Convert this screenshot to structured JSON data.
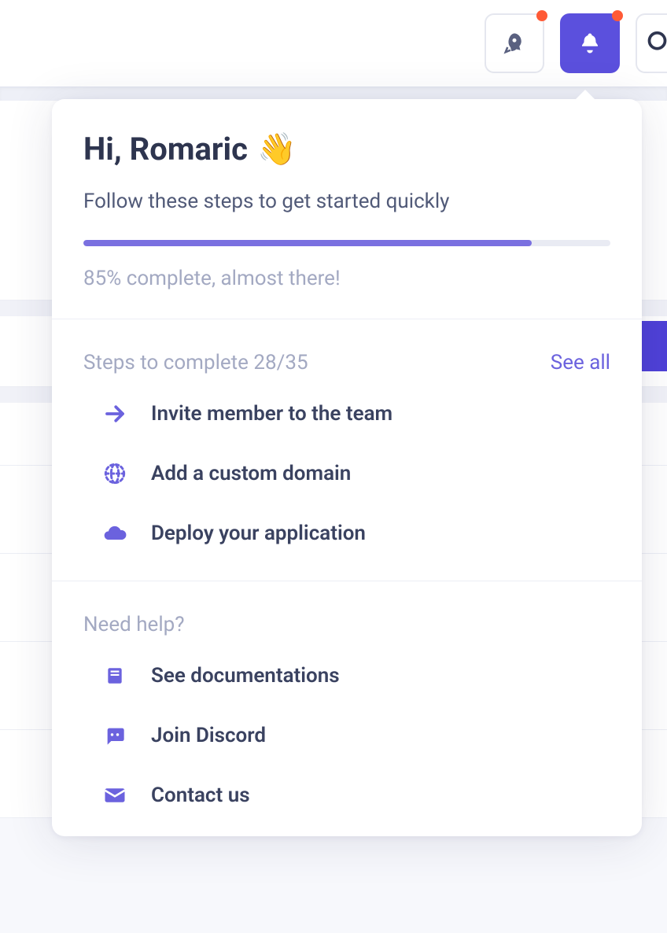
{
  "colors": {
    "accent": "#5b50dd",
    "badge": "#ff5a36"
  },
  "greeting": {
    "prefix": "Hi, ",
    "name": "Romaric",
    "wave": "👋"
  },
  "onboarding": {
    "subtitle": "Follow these steps to get started quickly",
    "progress_percent": 85,
    "progress_text": "85% complete, almost there!"
  },
  "steps_section": {
    "title_prefix": "Steps to complete ",
    "completed": 28,
    "total": 35,
    "see_all_label": "See all",
    "items": [
      {
        "icon": "arrow-right",
        "label": "Invite member to the team"
      },
      {
        "icon": "globe",
        "label": "Add a custom domain"
      },
      {
        "icon": "cloud",
        "label": "Deploy your application"
      }
    ]
  },
  "help_section": {
    "title": "Need help?",
    "items": [
      {
        "icon": "book",
        "label": "See documentations"
      },
      {
        "icon": "discord",
        "label": "Join Discord"
      },
      {
        "icon": "envelope",
        "label": "Contact us"
      }
    ]
  }
}
